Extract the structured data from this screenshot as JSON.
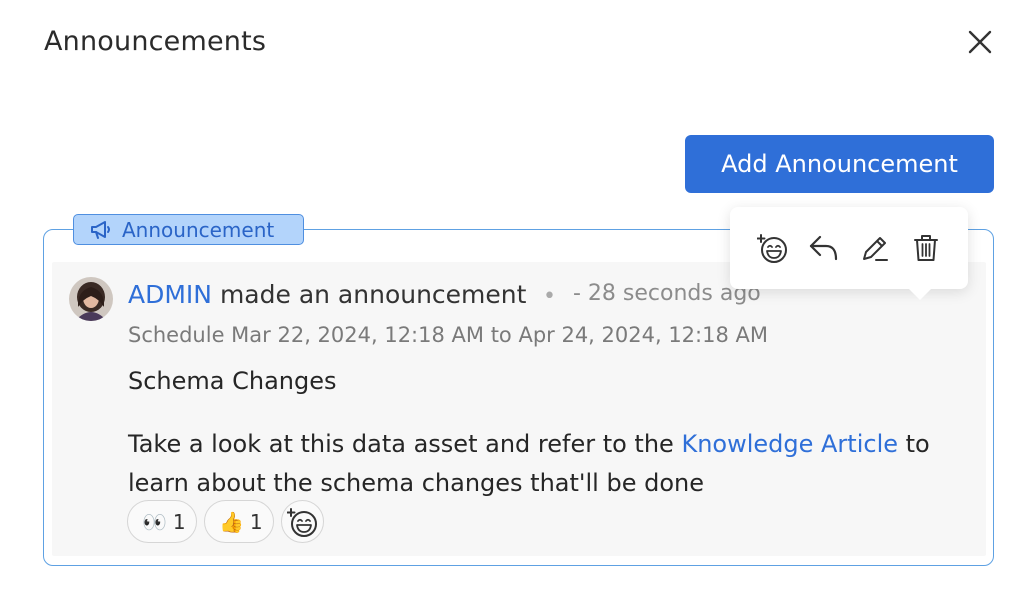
{
  "modal": {
    "title": "Announcements",
    "close_icon": "close-icon"
  },
  "toolbar": {
    "add_label": "Add Announcement",
    "accent_color": "#2f6fd8"
  },
  "announcement": {
    "tag_label": "Announcement",
    "tag_icon": "megaphone-icon",
    "author": "ADMIN",
    "action_text": "made an announcement",
    "separator": "•",
    "time_ago": "- 28 seconds ago",
    "schedule": "Schedule Mar 22, 2024, 12:18 AM to Apr 24, 2024, 12:18 AM",
    "subject": "Schema Changes",
    "body_before": "Take a look at this data asset and refer to the ",
    "link_text": "Knowledge Article",
    "body_after": " to learn about the schema changes that'll be done",
    "reactions": [
      {
        "emoji": "👀",
        "count": "1"
      },
      {
        "emoji": "👍",
        "count": "1"
      }
    ],
    "add_reaction_icon": "add-emoji-icon"
  },
  "popover": {
    "icons": [
      "add-emoji-icon",
      "reply-icon",
      "edit-icon",
      "delete-icon"
    ]
  }
}
